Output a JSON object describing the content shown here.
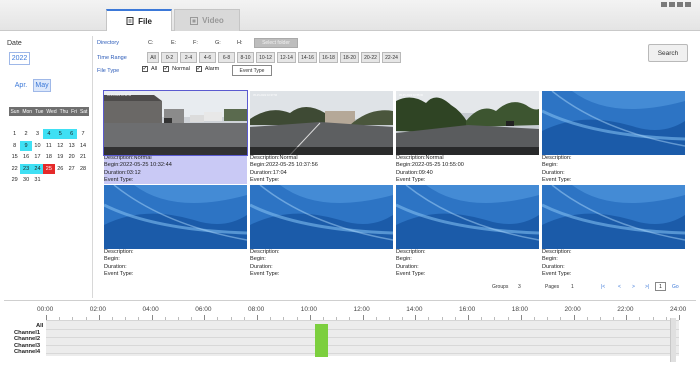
{
  "tabs": [
    {
      "label": "File"
    },
    {
      "label": "Video"
    }
  ],
  "left": {
    "date_label": "Date",
    "year": "2022",
    "months": [
      "Apr.",
      "May"
    ],
    "weekdays": [
      "Sun",
      "Mon",
      "Tue",
      "Wed",
      "Thu",
      "Fri",
      "Sat"
    ],
    "weeks": [
      [
        {
          "d": "1"
        },
        {
          "d": "2"
        },
        {
          "d": "3"
        },
        {
          "d": "4",
          "hl": true
        },
        {
          "d": "5",
          "hl": true
        },
        {
          "d": "6",
          "hl": true
        },
        {
          "d": "7"
        }
      ],
      [
        {
          "d": "8"
        },
        {
          "d": "9",
          "hl": true
        },
        {
          "d": "10"
        },
        {
          "d": "11"
        },
        {
          "d": "12"
        },
        {
          "d": "13"
        },
        {
          "d": "14"
        }
      ],
      [
        {
          "d": "15"
        },
        {
          "d": "16"
        },
        {
          "d": "17"
        },
        {
          "d": "18"
        },
        {
          "d": "19"
        },
        {
          "d": "20"
        },
        {
          "d": "21"
        }
      ],
      [
        {
          "d": "22"
        },
        {
          "d": "23",
          "hl": true
        },
        {
          "d": "24",
          "hl": true
        },
        {
          "d": "25",
          "red": true
        },
        {
          "d": "26"
        },
        {
          "d": "27"
        },
        {
          "d": "28"
        }
      ],
      [
        {
          "d": "29"
        },
        {
          "d": "30"
        },
        {
          "d": "31"
        },
        {
          "d": ""
        },
        {
          "d": ""
        },
        {
          "d": ""
        },
        {
          "d": ""
        }
      ]
    ]
  },
  "filters": {
    "directory_label": "Directory",
    "drives": [
      "C:",
      "E:",
      "F:",
      "G:",
      "H:"
    ],
    "select_folder": "Select folder",
    "time_range_label": "Time Range",
    "time_ranges": [
      "All",
      "0-2",
      "2-4",
      "4-6",
      "6-8",
      "8-10",
      "10-12",
      "12-14",
      "14-16",
      "16-18",
      "18-20",
      "20-22",
      "22-24"
    ],
    "file_type_label": "File Type",
    "file_types": [
      "All",
      "Normal",
      "Alarm"
    ],
    "event_type_button": "Event Type",
    "search_button": "Search"
  },
  "files": [
    {
      "desc": "Description:Normal",
      "begin": "Begin:2022-05-25 10:32:44",
      "duration": "Duration:03:12",
      "event": "Event Type:",
      "thumb": "parking",
      "stamp": "05-25-2022 10:32:44"
    },
    {
      "desc": "Description:Normal",
      "begin": "Begin:2022-05-25 10:37:56",
      "duration": "Duration:17:04",
      "event": "Event Type:",
      "thumb": "road",
      "stamp": "05-25-2022 10:37:56"
    },
    {
      "desc": "Description:Normal",
      "begin": "Begin:2022-05-25 10:55:00",
      "duration": "Duration:09:40",
      "event": "Event Type:",
      "thumb": "trees",
      "stamp": "05-25-2022 10:55:00"
    },
    {
      "desc": "Description:",
      "begin": "Begin:",
      "duration": "Duration:",
      "event": "Event Type:",
      "thumb": "blank",
      "stamp": ""
    },
    {
      "desc": "Description:",
      "begin": "Begin:",
      "duration": "Duration:",
      "event": "Event Type:",
      "thumb": "blank",
      "stamp": ""
    },
    {
      "desc": "Description:",
      "begin": "Begin:",
      "duration": "Duration:",
      "event": "Event Type:",
      "thumb": "blank",
      "stamp": ""
    },
    {
      "desc": "Description:",
      "begin": "Begin:",
      "duration": "Duration:",
      "event": "Event Type:",
      "thumb": "blank",
      "stamp": ""
    },
    {
      "desc": "Description:",
      "begin": "Begin:",
      "duration": "Duration:",
      "event": "Event Type:",
      "thumb": "blank",
      "stamp": ""
    }
  ],
  "pager": {
    "groups_label": "Groups",
    "groups_value": "3",
    "pages_label": "Pages",
    "pages_value": "1",
    "first": "|<",
    "prev": "<",
    "next": ">",
    "last": ">|",
    "page_input": "1",
    "go": "Go"
  },
  "timeline": {
    "ticks": [
      "00:00",
      "02:00",
      "04:00",
      "06:00",
      "08:00",
      "10:00",
      "12:00",
      "14:00",
      "16:00",
      "18:00",
      "20:00",
      "22:00",
      "24:00"
    ],
    "channels": [
      "All",
      "Channel1",
      "Channel2",
      "Channel3",
      "Channel4"
    ],
    "recording": {
      "start_hour": 10.2,
      "end_hour": 10.7,
      "color": "#7ccf3e"
    }
  },
  "colors": {
    "accent": "#3b78d8",
    "highlight": "#3fe0f4",
    "selected_day": "#e52a2a"
  }
}
